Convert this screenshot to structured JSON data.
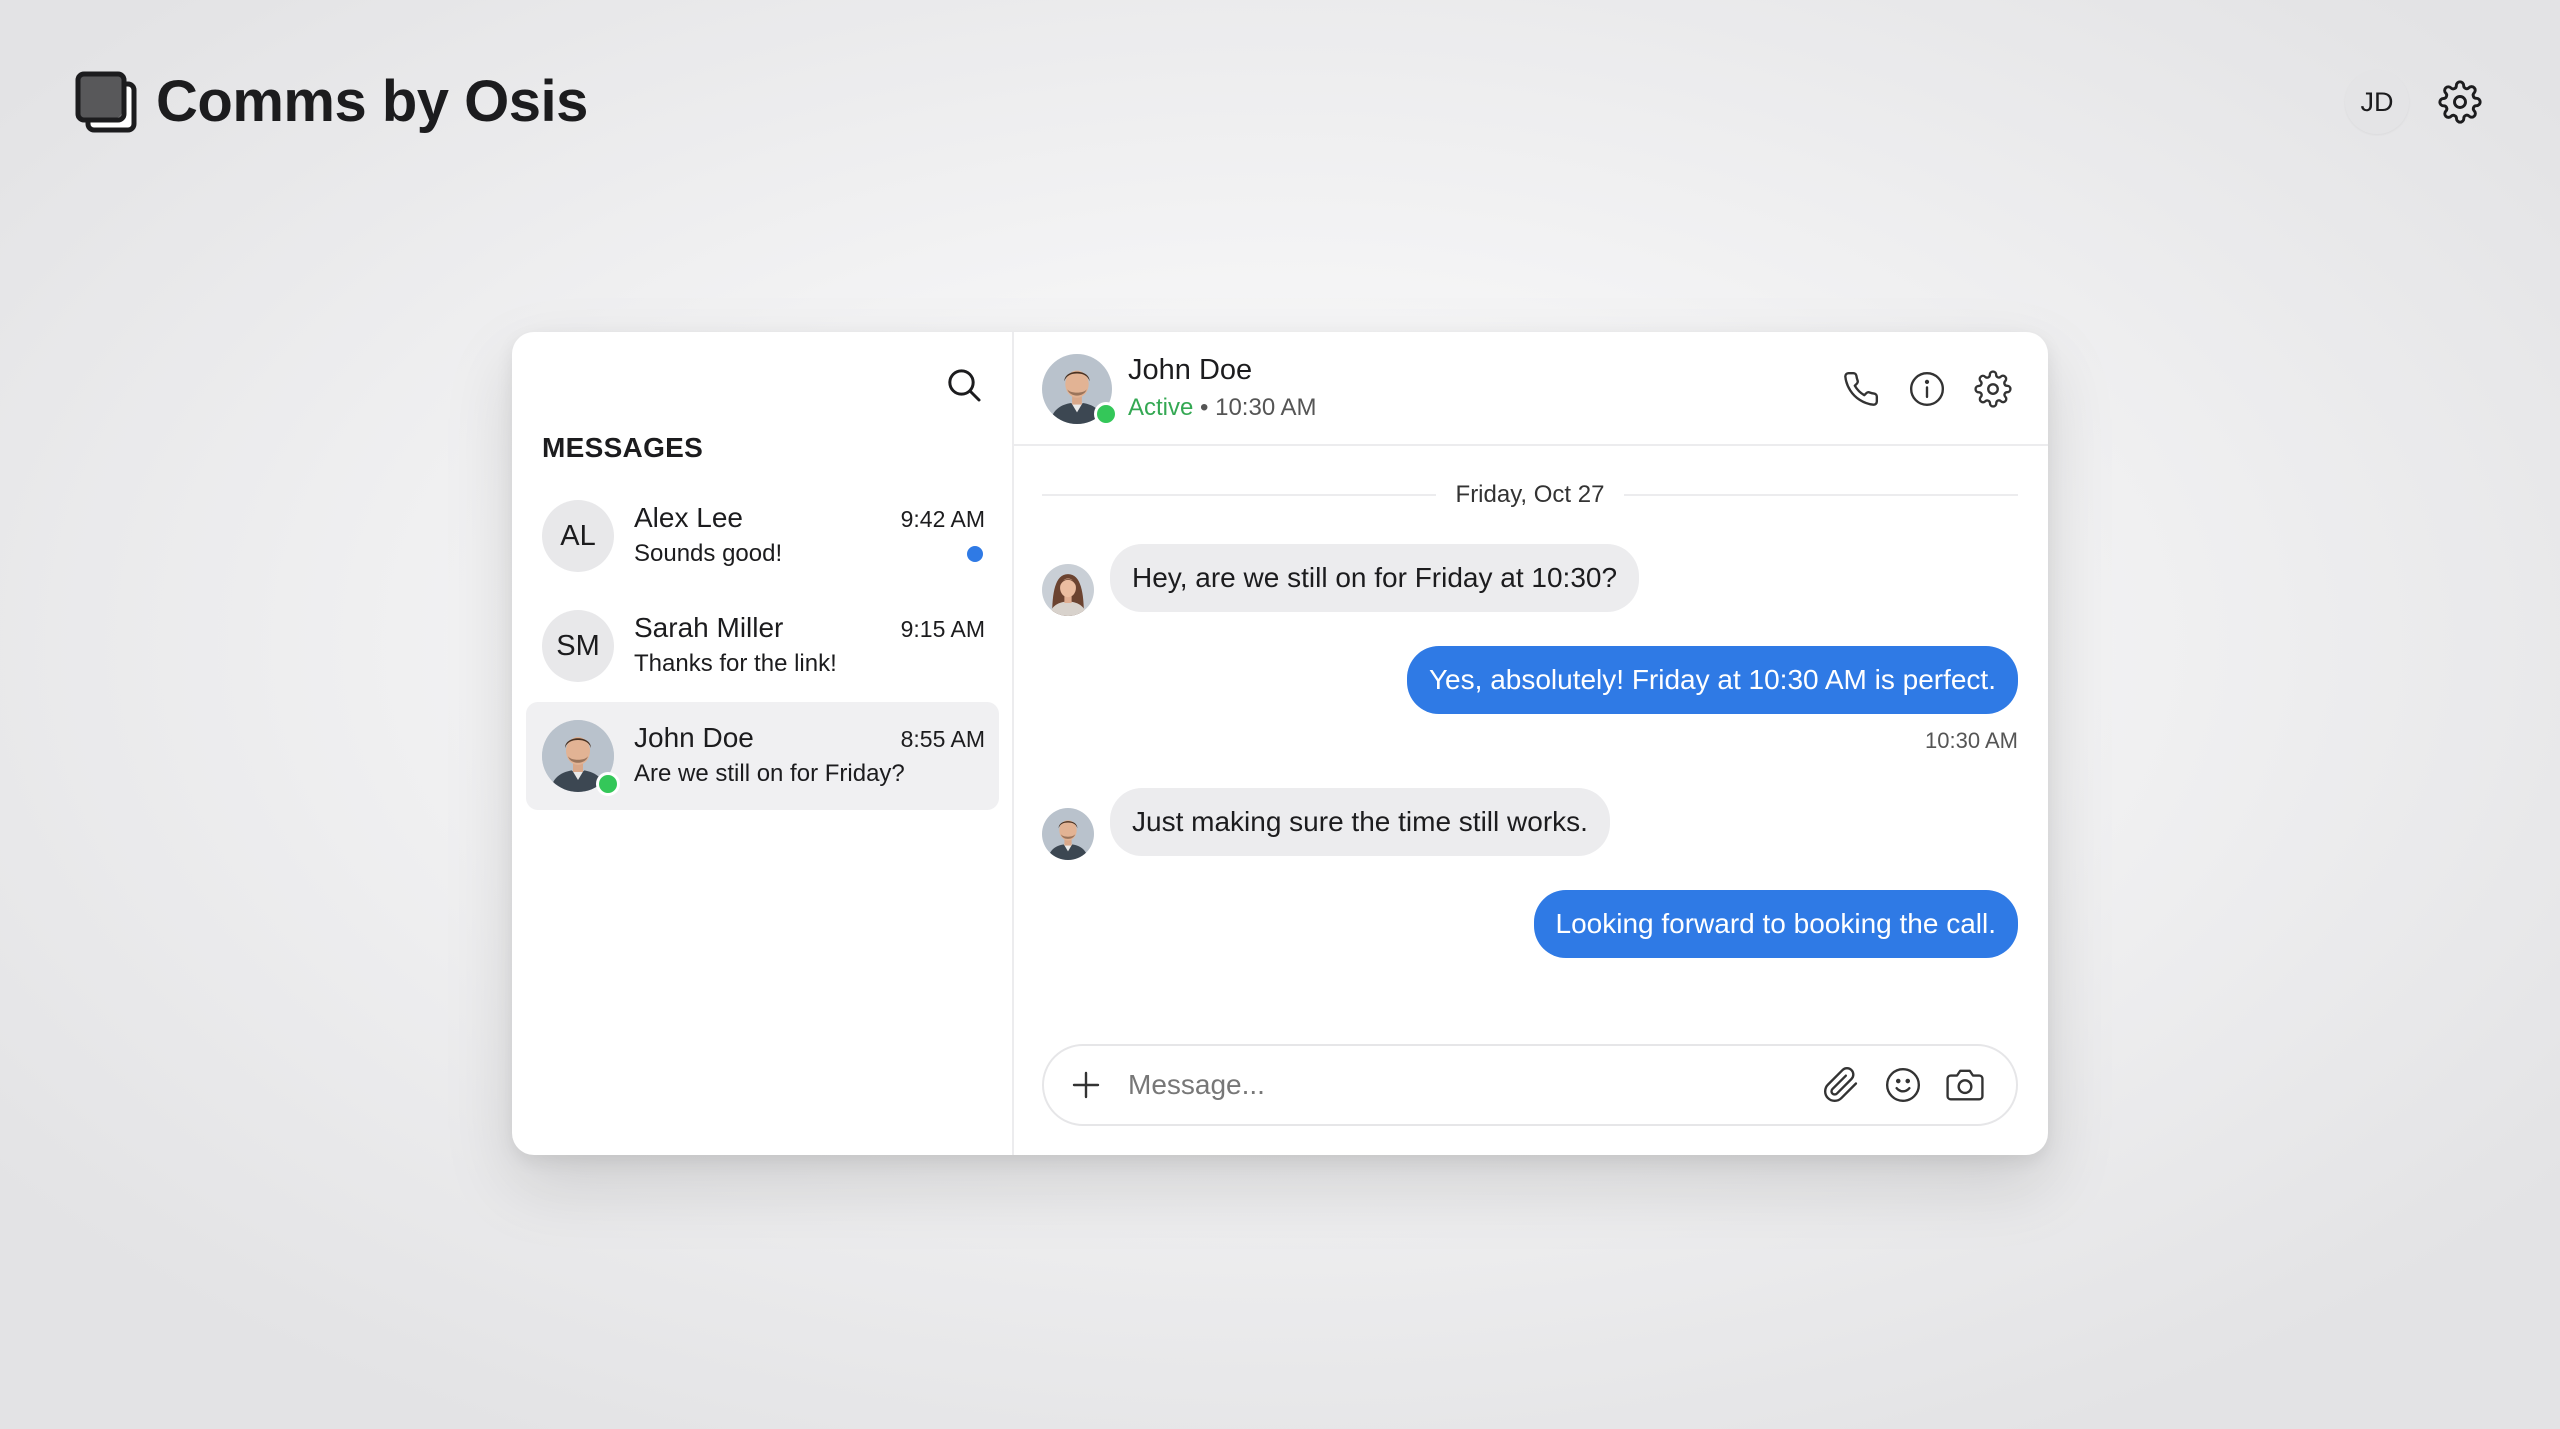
{
  "app": {
    "title": "Comms by Osis",
    "user_initials": "JD"
  },
  "sidebar": {
    "heading": "MESSAGES",
    "conversations": [
      {
        "name": "Alex Lee",
        "initials": "AL",
        "preview": "Sounds good!",
        "time": "9:42 AM",
        "unread": true
      },
      {
        "name": "Sarah Miller",
        "initials": "SM",
        "preview": "Thanks for the link!",
        "time": "9:15 AM",
        "unread": false
      },
      {
        "name": "John Doe",
        "initials": "",
        "preview": "Are we still on for Friday?",
        "time": "8:55 AM",
        "unread": false,
        "online": true,
        "active": true
      }
    ]
  },
  "chat": {
    "contact_name": "John Doe",
    "status": "Active",
    "status_separator": " • ",
    "status_time": "10:30 AM",
    "date_divider": "Friday, Oct 27",
    "messages": [
      {
        "direction": "incoming",
        "text": "Hey, are we still on for Friday at 10:30?"
      },
      {
        "direction": "outgoing",
        "text": "Yes, absolutely! Friday at 10:30 AM is perfect.",
        "time": "10:30 AM"
      },
      {
        "direction": "incoming",
        "text": "Just making sure the time still works."
      },
      {
        "direction": "outgoing",
        "text": "Looking forward to booking the call."
      }
    ],
    "composer_placeholder": "Message...",
    "composer_value": ""
  },
  "colors": {
    "accent": "#2f7ae5",
    "online": "#34c759",
    "active_status": "#34a853",
    "incoming_bubble": "#ececee"
  },
  "icons": [
    "app-logo-icon",
    "settings-gear-icon",
    "search-icon",
    "phone-icon",
    "info-icon",
    "plus-icon",
    "paperclip-icon",
    "emoji-icon",
    "camera-icon"
  ]
}
